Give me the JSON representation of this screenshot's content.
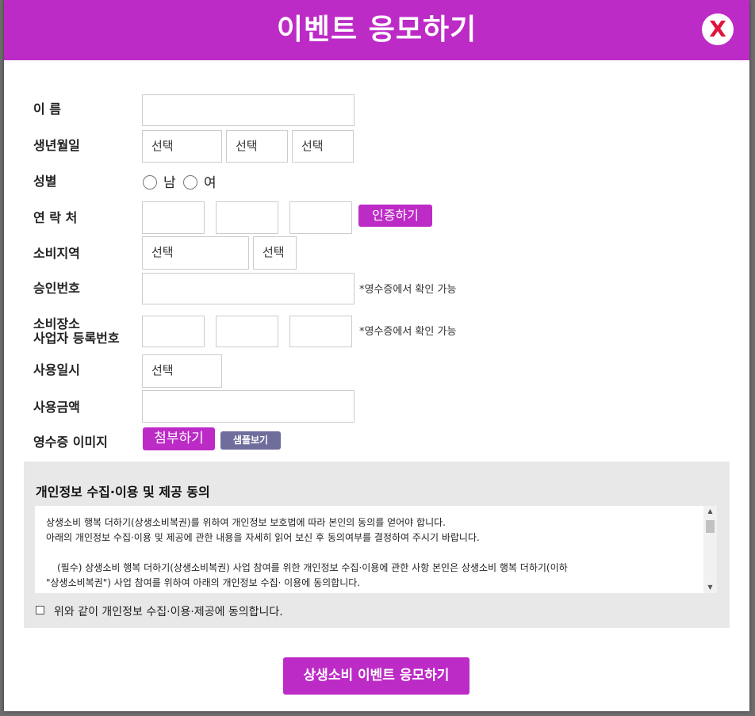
{
  "header": {
    "title": "이벤트 응모하기",
    "close_label": "X"
  },
  "form": {
    "name": {
      "label": "이 름",
      "value": ""
    },
    "birth": {
      "label": "생년월일",
      "year": "선택",
      "month": "선택",
      "day": "선택"
    },
    "gender": {
      "label": "성별",
      "male": "남",
      "female": "여"
    },
    "contact": {
      "label": "연 락 처",
      "verify_button": "인증하기"
    },
    "region": {
      "label": "소비지역",
      "city": "선택",
      "district": "선택"
    },
    "approval": {
      "label": "승인번호",
      "note": "*영수증에서 확인 가능"
    },
    "business": {
      "label_line1": "소비장소",
      "label_line2": "사업자 등록번호",
      "note": "*영수증에서 확인 가능"
    },
    "usage_date": {
      "label": "사용일시",
      "value": "선택"
    },
    "amount": {
      "label": "사용금액"
    },
    "receipt": {
      "label": "영수증 이미지",
      "attach_button": "첨부하기",
      "sample_button": "샘플보기"
    }
  },
  "consent": {
    "title": "개인정보 수집·이용 및 제공 동의",
    "lines": [
      "상생소비 행복 더하기(상생소비복권)를 위하여 개인정보 보호법에 따라 본인의 동의를 얻어야 합니다.",
      "아래의 개인정보 수집·이용 및 제공에 관한 내용을 자세히 읽어 보신 후 동의여부를 결정하여 주시기 바랍니다.",
      "(필수) 상생소비 행복 더하기(상생소비복권) 사업 참여를 위한 개인정보 수집·이용에 관한 사항 본인은 상생소비 행복 더하기(이하",
      "\"상생소비복권\") 사업 참여를 위하여 아래의 개인정보 수집· 이용에 동의합니다."
    ],
    "agree_label": "위와 같이 개인정보 수집·이용·제공에 동의합니다."
  },
  "submit_label": "상생소비 이벤트 응모하기"
}
